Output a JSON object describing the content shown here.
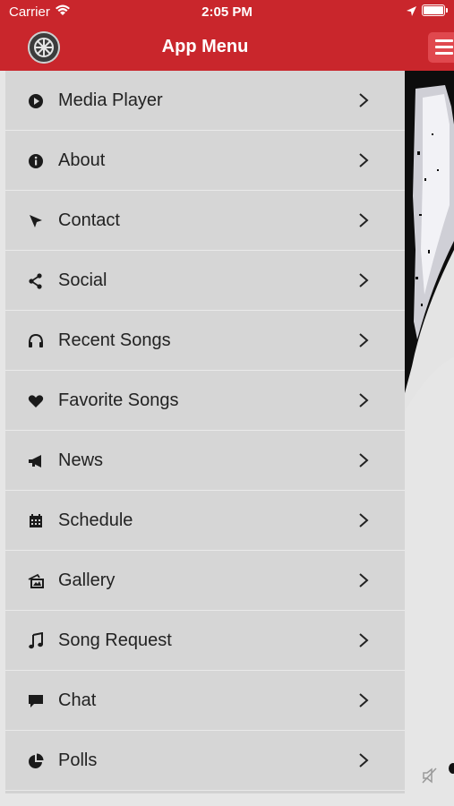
{
  "status_bar": {
    "carrier": "Carrier",
    "time": "2:05 PM"
  },
  "header": {
    "title": "App Menu"
  },
  "colors": {
    "header_red": "#c9262c",
    "menu_bg": "#d6d6d6"
  },
  "menu": {
    "items": [
      {
        "label": "Media Player",
        "icon": "play-circle-icon"
      },
      {
        "label": "About",
        "icon": "info-icon"
      },
      {
        "label": "Contact",
        "icon": "cursor-icon"
      },
      {
        "label": "Social",
        "icon": "share-icon"
      },
      {
        "label": "Recent Songs",
        "icon": "headphones-icon"
      },
      {
        "label": "Favorite Songs",
        "icon": "heart-icon"
      },
      {
        "label": "News",
        "icon": "megaphone-icon"
      },
      {
        "label": "Schedule",
        "icon": "calendar-icon"
      },
      {
        "label": "Gallery",
        "icon": "gallery-icon"
      },
      {
        "label": "Song Request",
        "icon": "music-note-icon"
      },
      {
        "label": "Chat",
        "icon": "chat-icon"
      },
      {
        "label": "Polls",
        "icon": "pie-chart-icon"
      }
    ]
  }
}
